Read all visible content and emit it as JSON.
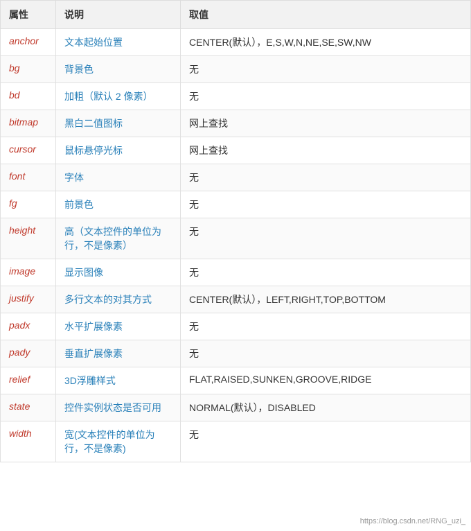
{
  "table": {
    "headers": [
      "属性",
      "说明",
      "取值"
    ],
    "rows": [
      {
        "attr": "anchor",
        "desc": "文本起始位置",
        "value": "CENTER(默认），E,S,W,N,NE,SE,SW,NW"
      },
      {
        "attr": "bg",
        "desc": "背景色",
        "value": "无"
      },
      {
        "attr": "bd",
        "desc": "加粗（默认 2 像素）",
        "value": "无"
      },
      {
        "attr": "bitmap",
        "desc": "黑白二值图标",
        "value": "网上查找"
      },
      {
        "attr": "cursor",
        "desc": "鼠标悬停光标",
        "value": "网上查找"
      },
      {
        "attr": "font",
        "desc": "字体",
        "value": "无"
      },
      {
        "attr": "fg",
        "desc": "前景色",
        "value": "无"
      },
      {
        "attr": "height",
        "desc": "高（文本控件的单位为行，不是像素）",
        "value": "无"
      },
      {
        "attr": "image",
        "desc": "显示图像",
        "value": "无"
      },
      {
        "attr": "justify",
        "desc": "多行文本的对其方式",
        "value": "CENTER(默认），LEFT,RIGHT,TOP,BOTTOM"
      },
      {
        "attr": "padx",
        "desc": "水平扩展像素",
        "value": "无"
      },
      {
        "attr": "pady",
        "desc": "垂直扩展像素",
        "value": "无"
      },
      {
        "attr": "relief",
        "desc": "3D浮雕样式",
        "value": "FLAT,RAISED,SUNKEN,GROOVE,RIDGE"
      },
      {
        "attr": "state",
        "desc": "控件实例状态是否可用",
        "value": "NORMAL(默认），DISABLED"
      },
      {
        "attr": "width",
        "desc": "宽(文本控件的单位为行，不是像素)",
        "value": "无"
      }
    ]
  },
  "watermark": "https://blog.csdn.net/RNG_uzi_"
}
